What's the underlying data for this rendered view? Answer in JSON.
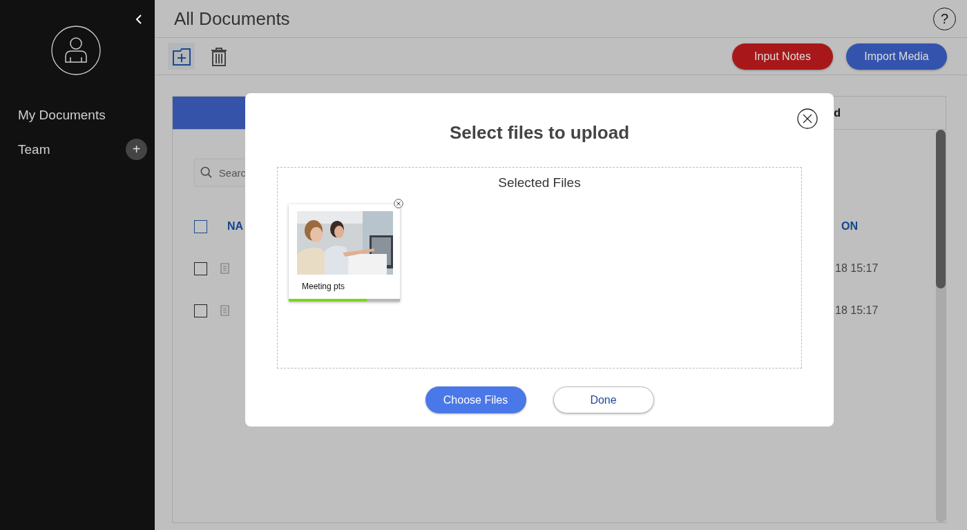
{
  "sidebar": {
    "items": [
      {
        "label": "My Documents"
      },
      {
        "label": "Team",
        "action": "+"
      }
    ]
  },
  "header": {
    "title": "All Documents",
    "help": "?"
  },
  "toolbar": {
    "buttons": [
      {
        "label": "Input Notes",
        "kind": "danger"
      },
      {
        "label": "Import Media",
        "kind": "primary"
      }
    ]
  },
  "tabs": [
    {
      "selected": true
    },
    {
      "label": "d",
      "selected": false
    }
  ],
  "search": {
    "placeholder": "Searc"
  },
  "table": {
    "columns": [
      "NA",
      "ON"
    ],
    "select_all_checked": false,
    "rows": [
      {
        "date": "18 15:17",
        "checked": false
      },
      {
        "date": "18 15:17",
        "checked": false
      }
    ]
  },
  "dialog": {
    "title": "Select files to upload",
    "dropzone_title": "Selected Files",
    "files": [
      {
        "name": "Meeting pts",
        "level": 0.7
      }
    ],
    "buttons": [
      {
        "label": "Choose Files",
        "kind": "primary"
      },
      {
        "label": "Done",
        "kind": "secondary"
      }
    ]
  }
}
